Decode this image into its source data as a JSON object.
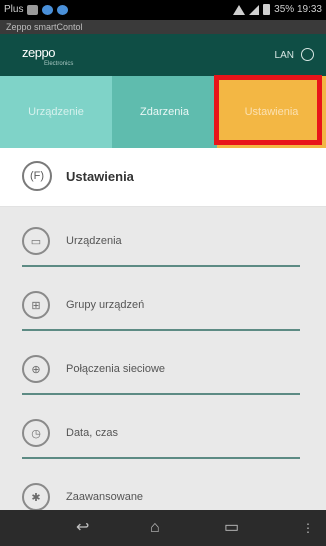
{
  "status_bar": {
    "carrier": "Plus",
    "right_text": "35% 19:33",
    "icons": [
      "image-icon",
      "sync-icon",
      "globe-icon",
      "wifi-icon",
      "signal-icon",
      "battery-icon"
    ]
  },
  "app": {
    "window_title": "Zeppo smartContol",
    "logo": "zeppo",
    "logo_sub": "Electronics",
    "connection_label": "LAN"
  },
  "tabs": [
    {
      "label": "Urządzenie"
    },
    {
      "label": "Zdarzenia"
    },
    {
      "label": "Ustawienia"
    }
  ],
  "settings": {
    "title": "Ustawienia",
    "icon_text": "(F)"
  },
  "menu": {
    "items": [
      {
        "label": "Urządzenia",
        "icon": "devices-icon"
      },
      {
        "label": "Grupy urządzeń",
        "icon": "device-groups-icon"
      },
      {
        "label": "Połączenia sieciowe",
        "icon": "network-icon"
      },
      {
        "label": "Data, czas",
        "icon": "clock-icon"
      },
      {
        "label": "Zaawansowane",
        "icon": "advanced-icon"
      }
    ]
  },
  "colors": {
    "header": "#0f4e45",
    "tab_active": "#f3b744",
    "tab_inactive": "#7fd3c8",
    "tab_middle": "#5fbcae",
    "highlight": "#e8141a",
    "separator": "#2e6b61"
  }
}
